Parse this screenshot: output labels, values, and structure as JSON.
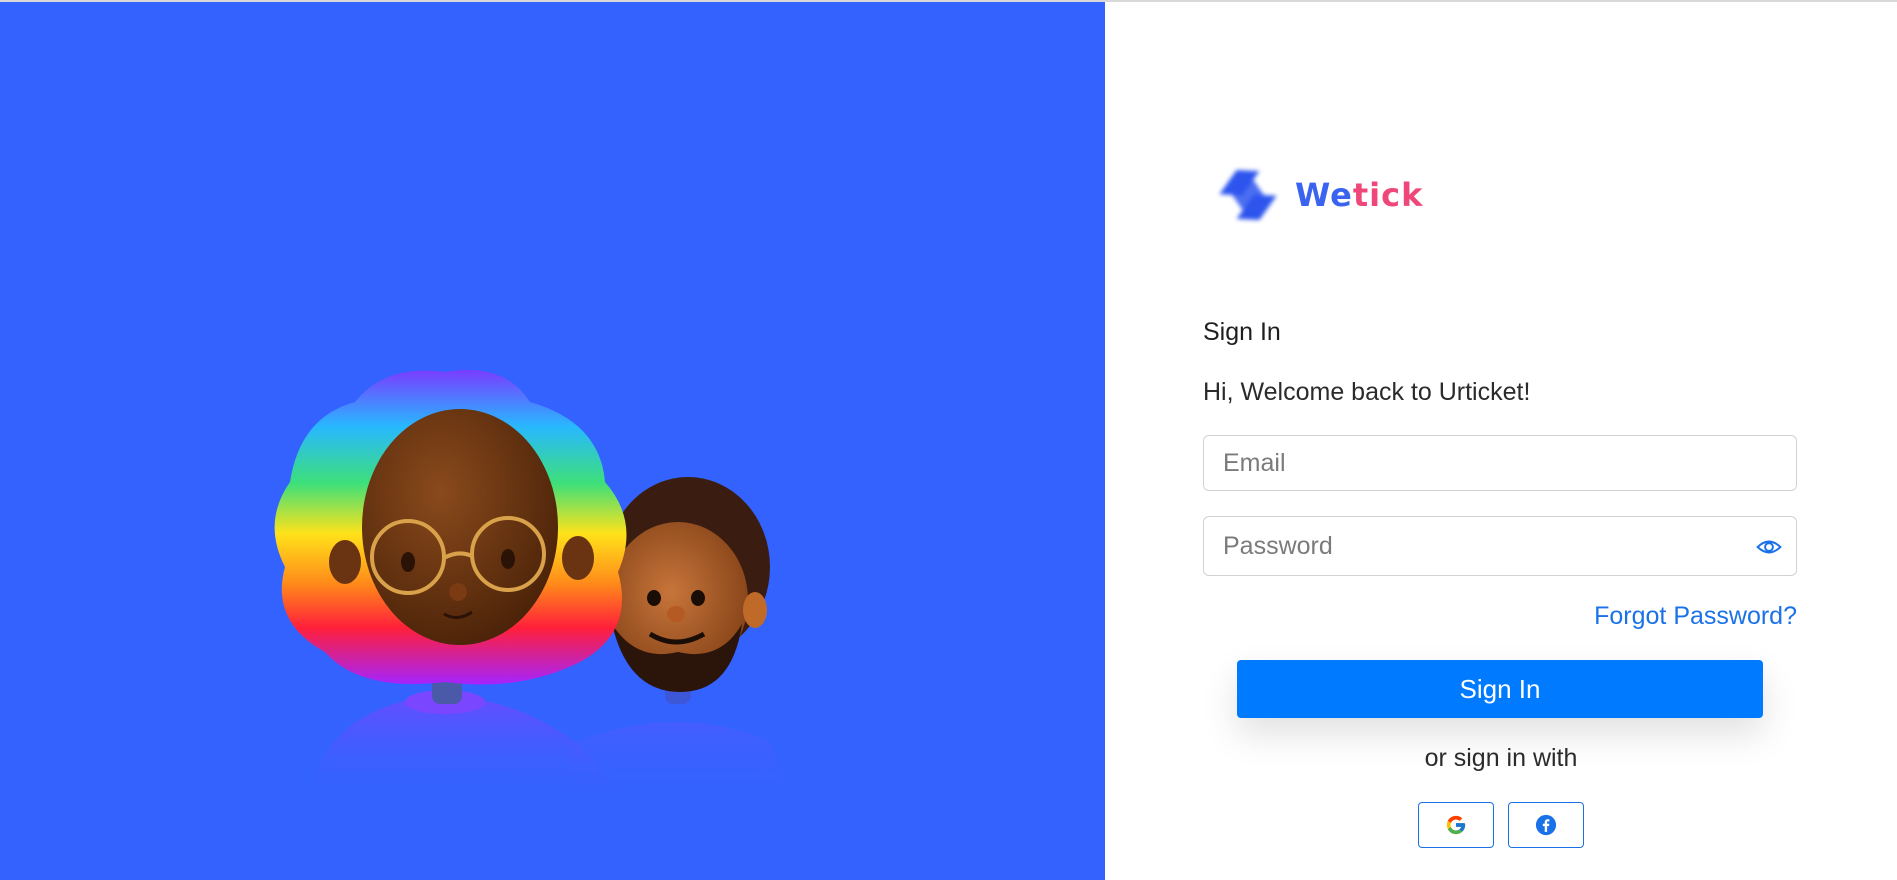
{
  "brand": {
    "part1": "We",
    "part2": "tick",
    "colors": {
      "we": "#3a63f0",
      "tick": "#f0477a",
      "mark": "#2d55ee"
    }
  },
  "hero": {
    "background": "#3462ff",
    "illustration": "two-3d-avatar-characters"
  },
  "form": {
    "heading": "Sign In",
    "welcome": "Hi, Welcome back to Urticket!",
    "email_placeholder": "Email",
    "password_placeholder": "Password",
    "password_toggle_icon": "eye-icon",
    "forgot_label": "Forgot Password?",
    "submit_label": "Sign In",
    "alt_label": "or sign in with",
    "social": [
      {
        "name": "google",
        "icon": "google-icon"
      },
      {
        "name": "facebook",
        "icon": "facebook-icon"
      }
    ]
  },
  "colors": {
    "primary": "#007bff",
    "link": "#1b72e8"
  }
}
